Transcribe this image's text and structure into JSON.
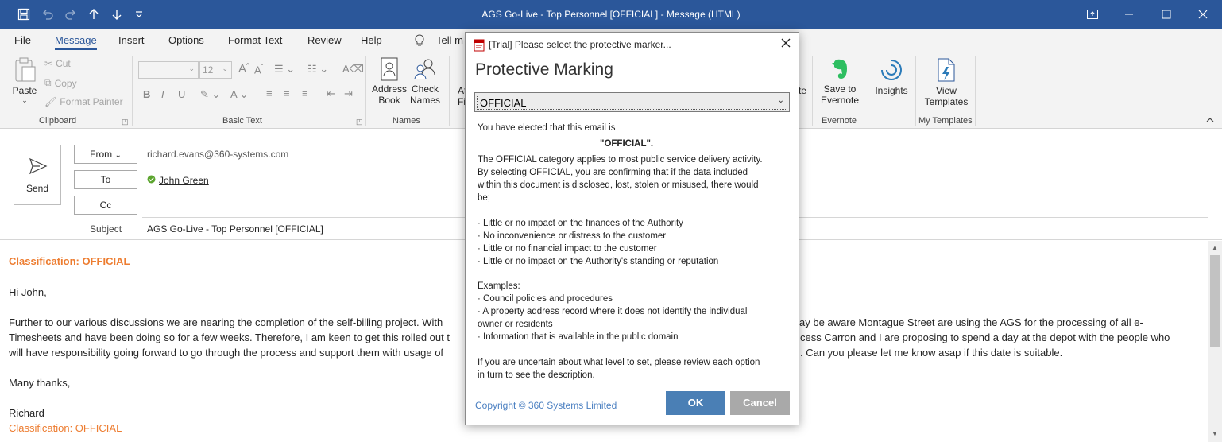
{
  "window": {
    "title": "AGS Go-Live - Top Personnel [OFFICIAL]  -  Message (HTML)"
  },
  "menu": {
    "tabs": [
      "File",
      "Message",
      "Insert",
      "Options",
      "Format Text",
      "Review",
      "Help"
    ],
    "tell_me": "Tell m"
  },
  "ribbon": {
    "clipboard": {
      "paste": "Paste",
      "cut": "Cut",
      "copy": "Copy",
      "format_painter": "Format Painter",
      "label": "Clipboard"
    },
    "basic_text": {
      "label": "Basic Text",
      "font_size": "12"
    },
    "names": {
      "address_book_1": "Address",
      "address_book_2": "Book",
      "check_names_1": "Check",
      "check_names_2": "Names",
      "label": "Names"
    },
    "partial_left_1": "At",
    "partial_left_2": "Fi",
    "partial_right": "te",
    "evernote": {
      "save_1": "Save to",
      "save_2": "Evernote",
      "label": "Evernote"
    },
    "insights": {
      "label_btn": "Insights"
    },
    "templates": {
      "view_1": "View",
      "view_2": "Templates",
      "label": "My Templates"
    }
  },
  "compose": {
    "send": "Send",
    "from_label": "From",
    "from_value": "richard.evans@360-systems.com",
    "to_label": "To",
    "to_value": "John Green",
    "cc_label": "Cc",
    "subject_label": "Subject",
    "subject_value": "AGS Go-Live - Top Personnel [OFFICIAL]"
  },
  "body": {
    "classification_top": "Classification: OFFICIAL",
    "greeting": "Hi John,",
    "para1_line1_left": "Further to our various discussions we are nearing the completion of the self-billing project.  With",
    "para1_line1_right": "ay be aware Montague Street are using the AGS for the processing of all e-",
    "para1_line2_left": "Timesheets and have been doing so for a few weeks. Therefore, I am keen to get this rolled out t",
    "para1_line2_right": "cess Carron and I are proposing to spend a day at the depot with the people who",
    "para1_line3_left": "will have responsibility going forward to go through the process and support them with usage of",
    "para1_line3_right": ". Can you please let me know asap if this date is suitable.",
    "thanks": "Many thanks,",
    "signature": "Richard",
    "classification_bottom": "Classification: OFFICIAL"
  },
  "dialog": {
    "title": "[Trial] Please select the protective marker...",
    "heading": "Protective Marking",
    "selected": "OFFICIAL",
    "elected": "You have elected that this email is",
    "elected_value": "\"OFFICIAL\".",
    "desc1": "The OFFICIAL category applies to most public service delivery activity.",
    "desc2": "By selecting OFFICIAL, you are confirming that if the data included",
    "desc3": "within this document is disclosed, lost, stolen or misused, there would",
    "desc4": "be;",
    "bullet1": "· Little or no impact on the finances of the Authority",
    "bullet2": "· No inconvenience or distress to the customer",
    "bullet3": "· Little or no financial impact to the customer",
    "bullet4": "· Little or no impact on the Authority's standing or reputation",
    "examples": "Examples:",
    "ex1": "· Council policies and procedures",
    "ex2a": "· A property address record where it does not identify the individual",
    "ex2b": "owner or residents",
    "ex3": "· Information that is available in the public domain",
    "uncertain1": "If you are uncertain about what level to set, please review each option",
    "uncertain2": "in turn to see the description.",
    "copyright": "Copyright © 360 Systems Limited",
    "ok": "OK",
    "cancel": "Cancel"
  },
  "colors": {
    "accent": "#2b579a",
    "classification": "#ed7d31",
    "ok_button": "#4a7fb5",
    "cancel_button": "#a9a9a9",
    "evernote": "#2dbe60"
  }
}
